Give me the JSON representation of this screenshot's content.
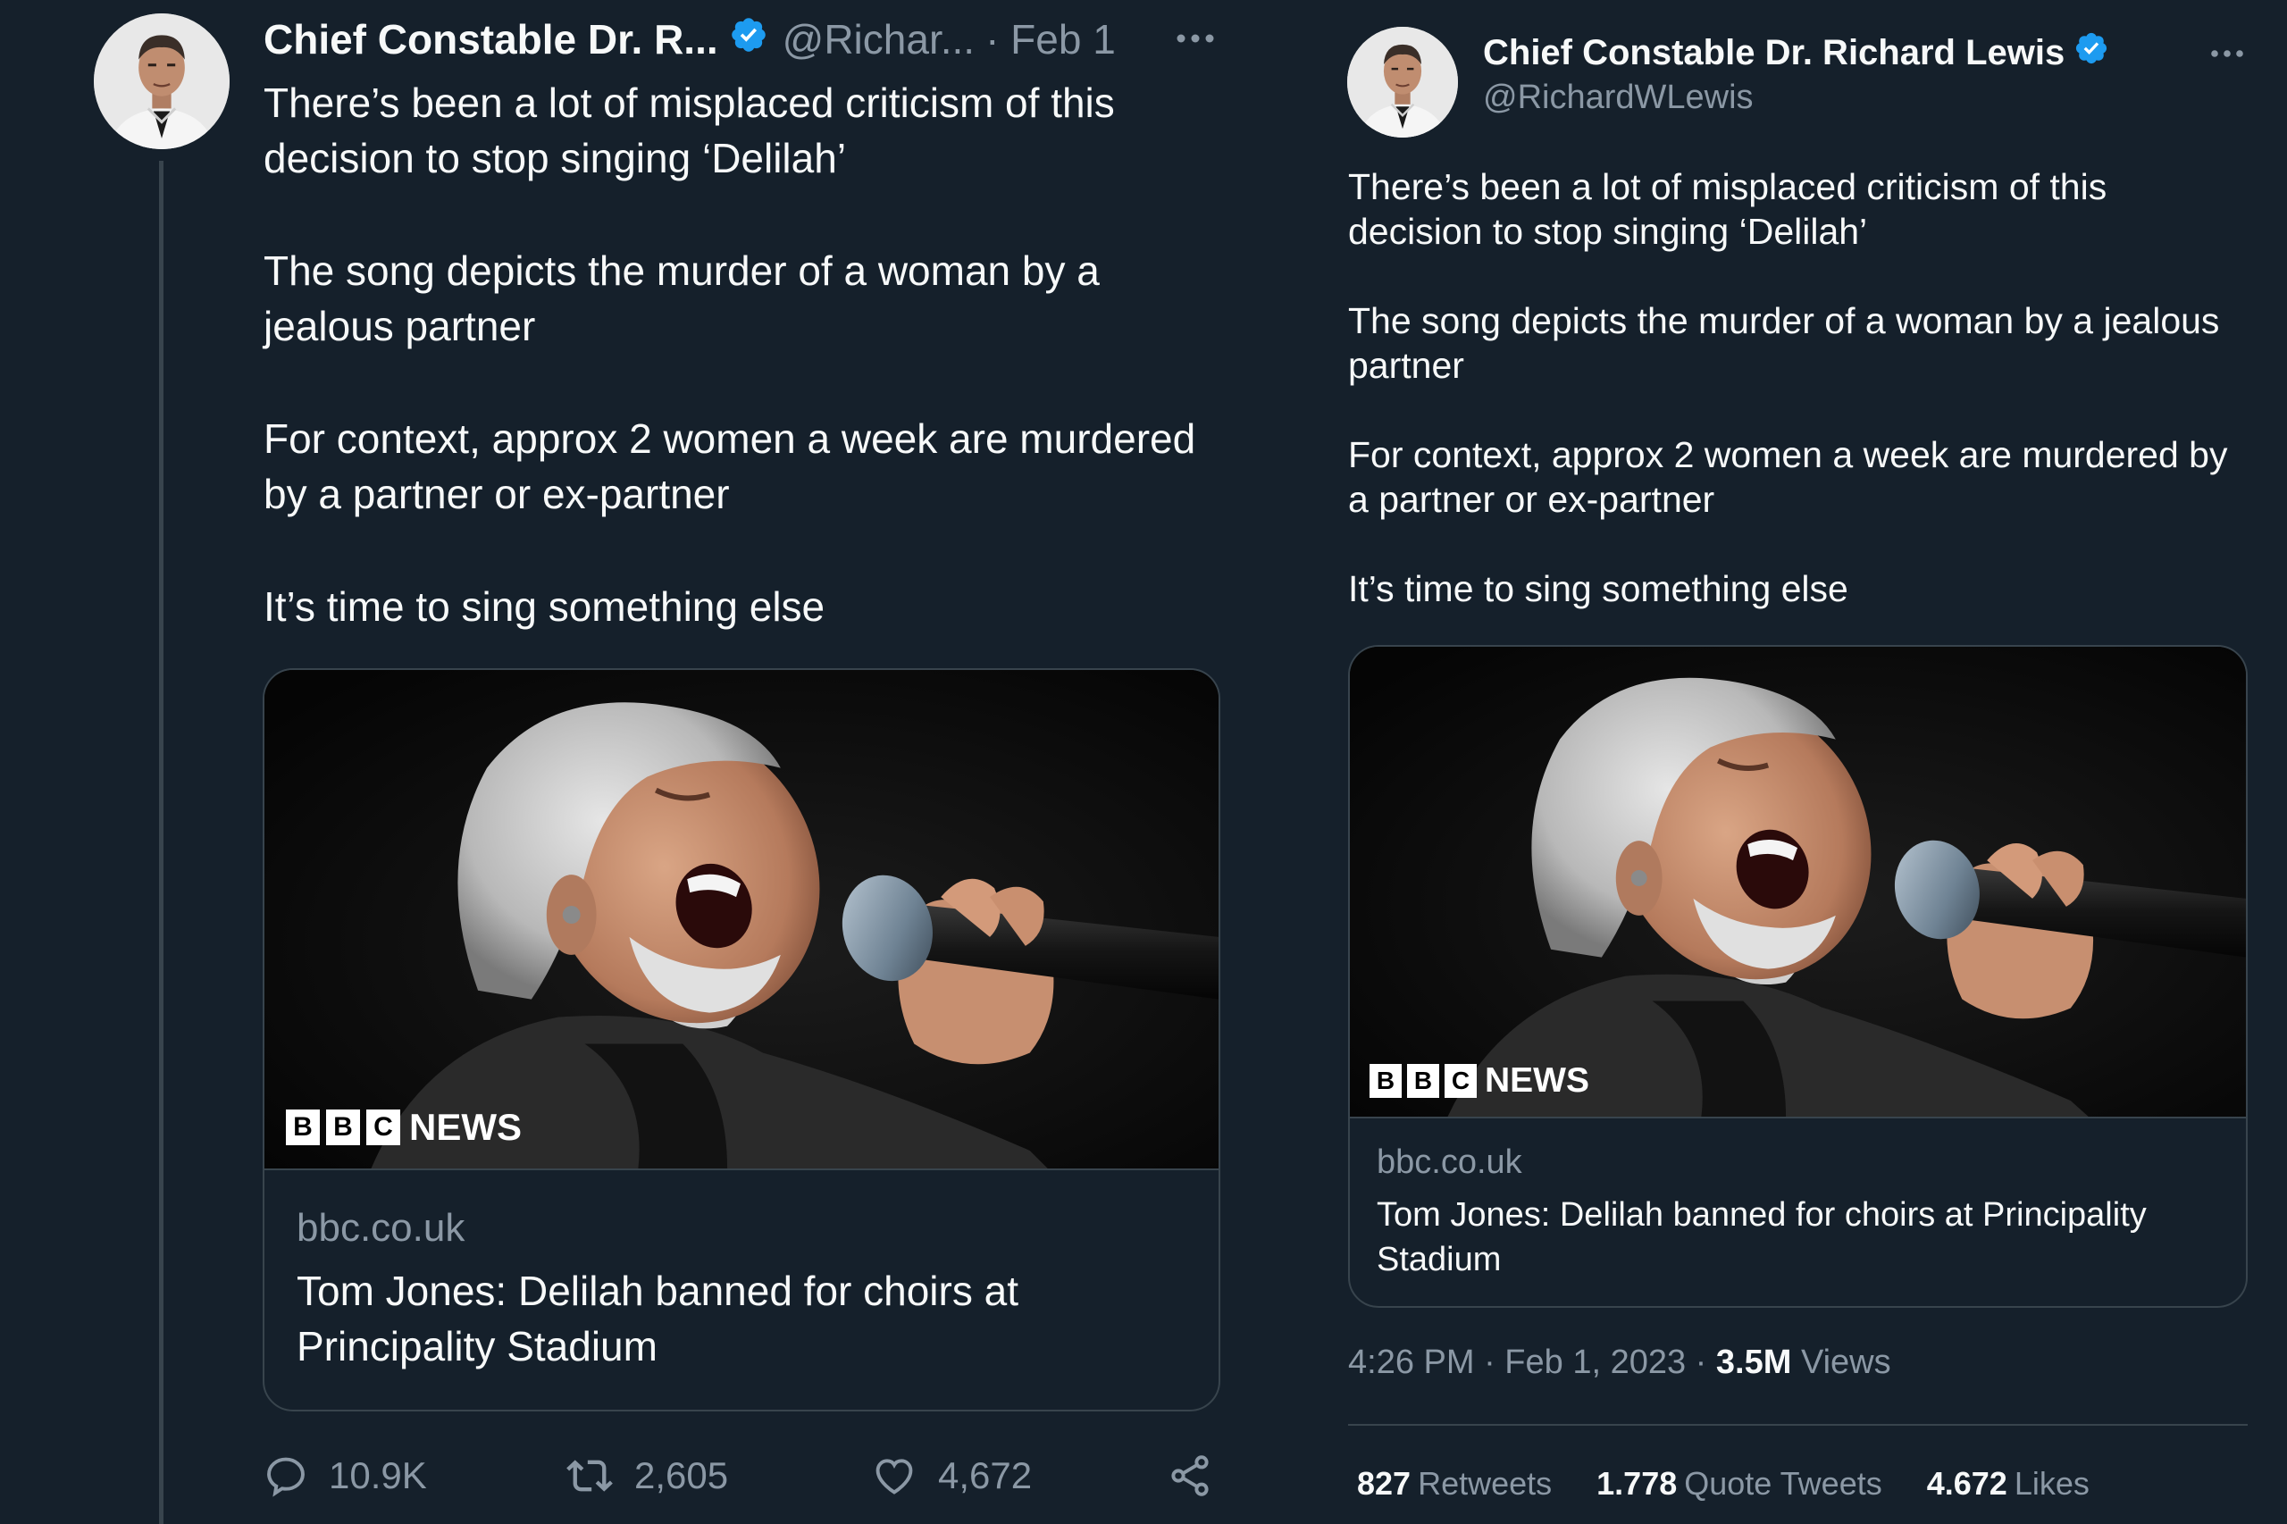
{
  "left_tweet": {
    "author_name": "Chief Constable Dr. R...",
    "handle": "@Richar...",
    "date": "· Feb 1",
    "paragraphs": [
      "There’s been a lot of misplaced criticism of this decision to stop singing ‘Delilah’",
      "The song depicts the murder of a woman by a jealous partner",
      "For context, approx 2 women a week are murdered by a partner or ex-partner",
      "It’s time to sing something else"
    ],
    "card": {
      "bbc_letters": [
        "B",
        "B",
        "C"
      ],
      "bbc_news": "NEWS",
      "domain": "bbc.co.uk",
      "title": "Tom Jones: Delilah banned for choirs at Principality Stadium"
    },
    "actions": {
      "replies": "10.9K",
      "retweets": "2,605",
      "likes": "4,672"
    }
  },
  "right_tweet": {
    "author_name": "Chief Constable Dr. Richard Lewis",
    "handle": "@RichardWLewis",
    "paragraphs": [
      "There’s been a lot of misplaced criticism of this decision to stop singing ‘Delilah’",
      "The song depicts the murder of a woman by a jealous partner",
      "For context, approx 2 women a week are murdered by a partner or ex-partner",
      "It’s time to sing something else"
    ],
    "card": {
      "bbc_letters": [
        "B",
        "B",
        "C"
      ],
      "bbc_news": "NEWS",
      "domain": "bbc.co.uk",
      "title": "Tom Jones: Delilah banned for choirs at Principality Stadium"
    },
    "timestamp": "4:26 PM · Feb 1, 2023 · ",
    "views_count": "3.5M",
    "views_label": "Views",
    "stats": {
      "retweets_count": "827",
      "retweets_label": "Retweets",
      "quotes_count": "1.778",
      "quotes_label": "Quote Tweets",
      "likes_count": "4.672",
      "likes_label": "Likes"
    }
  },
  "colors": {
    "background": "#15202b",
    "text_primary": "#f7f9f9",
    "text_secondary": "#8b98a5",
    "border": "#38444d",
    "verified_blue": "#1d9bf0"
  },
  "icons": [
    "verified-badge-icon",
    "more-options-icon",
    "reply-icon",
    "retweet-icon",
    "like-icon",
    "share-icon"
  ]
}
